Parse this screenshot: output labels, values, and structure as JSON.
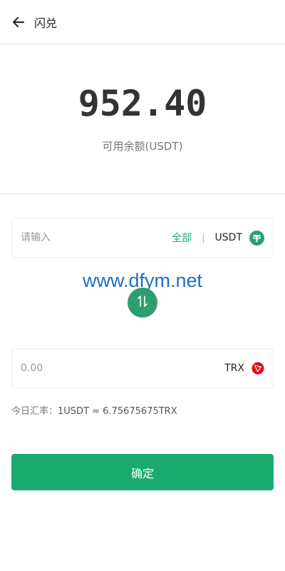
{
  "header": {
    "title": "闪兑",
    "back_icon": "arrow-left-icon"
  },
  "balance": {
    "value": "952.40",
    "label": "可用余额(USDT)"
  },
  "from": {
    "placeholder": "请输入",
    "all_label": "全部",
    "divider": "|",
    "currency": "USDT",
    "icon": "usdt-tether-icon",
    "icon_color": "#26a17b"
  },
  "watermark": "www.dfym.net",
  "swap": {
    "icon": "swap-arrows-icon",
    "color": "#2e9e6f"
  },
  "to": {
    "amount": "0.00",
    "currency": "TRX",
    "icon": "trx-tron-icon",
    "icon_color": "#e50914"
  },
  "rate": {
    "label": "今日汇率：",
    "value": "1USDT ≈ 6.75675675TRX"
  },
  "confirm": {
    "label": "确定",
    "color": "#1aab70"
  }
}
